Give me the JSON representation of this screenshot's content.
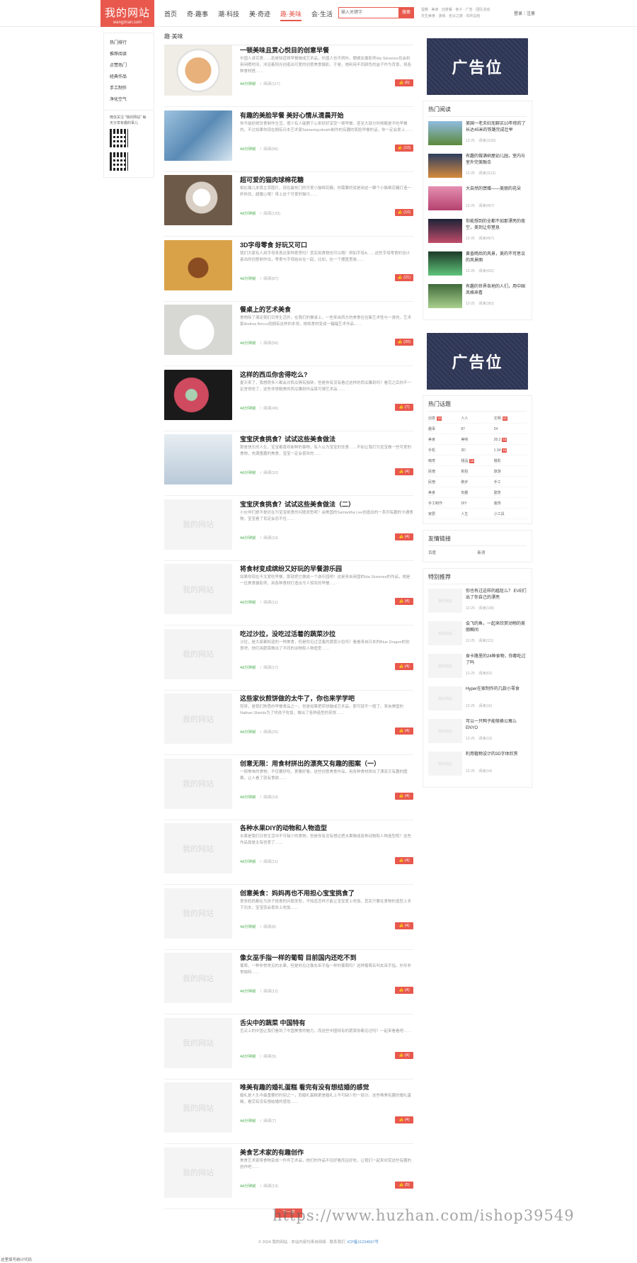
{
  "header": {
    "logo_title": "我的网站",
    "logo_sub": "wangzhan.com",
    "nav": [
      "首页",
      "奇·趣事",
      "潮·科技",
      "美·奇迹",
      "趣·美味",
      "会·生活"
    ],
    "search_placeholder": "输入关键字",
    "search_btn": "搜索",
    "hotwords_1": "蛋糕 · 美食 · 创意餐 · 亲子 · 广告 · 团队活动",
    "hotwords_2": "天生美食 · 游戏 · 舌尖之旅 · 年终总结",
    "login": "登录｜注册"
  },
  "left": {
    "menu": [
      "热门排行",
      "推荐阅读",
      "点赞热门",
      "经典作品",
      "手工制作",
      "净化空气"
    ],
    "qr_text": "微信关注 \"我的网站\" 每天分享有趣的事儿"
  },
  "main": {
    "crumb": "趣·美味",
    "items": [
      {
        "title": "一顿美味且赏心悦目的创意早餐",
        "desc": "中国人讲究食……若是知道将早餐做成艺术品，外国人也不例外。挪威女摄影师Ida Skivenes也会利用闲暇时间，沐浴着阳光创造出可爱的创意美食摄影，于是，她利用不同颜色的盒子作为背景，将各种食材搭……",
        "author": "4d分钟前",
        "reads": "阅读(117)",
        "likes": "(6)"
      },
      {
        "title": "有趣的美脸早餐 美好心情从清晨开始",
        "desc": "你不能拒绝饮食制作生活，很少有人能静下心来好好享受一顿早餐，甚至大部分时候都是不吃早餐的。不过如果你现在拥有日本艺术家Samantayokoshi制作的有趣的笑脸早餐的话，你一定会爱上……",
        "author": "4d分钟前",
        "reads": "阅读(96)",
        "likes": "(10)"
      },
      {
        "title": "超可爱的猫肉球棉花糖",
        "desc": "相比猫儿本尊主宰图片，现在最热门的可爱小猫棉花糖，你需要的就是用这一颗个小猫棉花糖打造一杯热饮，超暖心哦！带上这个可爱的猫爪……",
        "author": "4d分钟前",
        "reads": "阅读(133)",
        "likes": "(10)"
      },
      {
        "title": "3D字母零食 好玩又可口",
        "desc": "我们大家有人用字母来表达某种意思吗？其实用食物也可以哦！例如字母A……这些字母零食的设计者出的创意制作出，零食与字母结合在一起，比如，在一个摆盘里装……",
        "author": "4d分钟前",
        "reads": "阅读(87)",
        "likes": "(21)"
      },
      {
        "title": "餐桌上的艺术美食",
        "desc": "食物除了满足我们日常生活外，在我们的餐桌上，一些来自西方的美食往往集艺术性与一身的，艺术家Andrea Bricco就拥有这样的本领，她将食材变成一幅幅艺术作品……",
        "author": "4d分钟前",
        "reads": "阅读(58)",
        "likes": "(20)"
      },
      {
        "title": "这样的西瓜你舍得吃么?",
        "desc": "夏天来了，我想很多人都会对西瓜情有独钟，但是你有没有看过这样的西瓜雕刻吗？看完之后你不一定舍得吃了，这些非常精美的西瓜雕刻作品真可谓艺术品……",
        "author": "4d分钟前",
        "reads": "阅读(40)",
        "likes": "(7)"
      },
      {
        "title": "宝宝厌食挑食？试试这些美食做法",
        "desc": "那是快乐的人生，宝宝都喜欢新鲜的事物，有人认为宝宝的饮食……不如让我们为宝宝做一些可爱的食物，充满童趣的美食，宝宝一定会喜欢的……",
        "author": "4d分钟前",
        "reads": "阅读(10)",
        "likes": "(4)"
      },
      {
        "title": "宝宝厌食挑食？试试这些美食做法（二）",
        "desc": "小伙伴们是不是还在为宝宝挑食的问题发愁呢？由美国的Samantha Lee创造出的一系列有趣的卡通食物，宝宝看了肯定会忍不住……",
        "author": "4d分钟前",
        "reads": "阅读(10)",
        "likes": "(4)"
      },
      {
        "title": "将食材变成缤纷又好玩的早餐游乐园",
        "desc": "如果你现在不太爱吃早餐，那就把它做成一个游乐园吧！这是来自英国的Ida Skivenes的作品，她是一位美食摄影师，用各种食材打造出令人惊叹的早餐……",
        "author": "4d分钟前",
        "reads": "阅读(11)",
        "likes": "(4)"
      },
      {
        "title": "吃过沙拉，没吃过活着的蔬菜沙拉",
        "desc": "沙拉，是大家都知道的一种美食，但是你见过活着的蔬菜沙拉吗？看看来自日本的Blue Dragon的创意吧，他们用蔬菜做出了不同的动物和人物造型……",
        "author": "4d分钟前",
        "reads": "阅读(17)",
        "likes": "(4)"
      },
      {
        "title": "这些家伙煎饼做的太牛了，你也来学学吧",
        "desc": "煎饼，是我们熟悉的早餐食品之一。但是如果把煎饼做成艺术品，那可就不一般了。来自美国的Nathan Shields为了哄孩子吃饭，做出了各种造型的煎饼……",
        "author": "4d分钟前",
        "reads": "阅读(20)",
        "likes": "(4)"
      },
      {
        "title": "创意无限：用食材拼出的漂亮又有趣的图案（一）",
        "desc": "一顿美味的食物，不仅要好吃，更要好看。这些创意美食作品，用各种食材拼出了漂亮又有趣的图案，让人看了就有食欲……",
        "author": "4d分钟前",
        "reads": "阅读(10)",
        "likes": "(4)"
      },
      {
        "title": "各种水果DIY的动物和人物造型",
        "desc": "水果是我们日常生活中不可缺少的食物，但是你有没有想过把水果做成各种动物和人物造型呢？这些作品真是太有创意了……",
        "author": "4d分钟前",
        "reads": "阅读(11)",
        "likes": "(4)"
      },
      {
        "title": "创意美食：妈妈再也不用担心宝宝挑食了",
        "desc": "很多妈妈都在为孩子挑食的问题发愁，不知道怎样才能让宝宝爱上吃饭。其实只要在食物的造型上多下功夫，宝宝就会喜欢上吃饭……",
        "author": "4d分钟前",
        "reads": "阅读(8)",
        "likes": "(4)"
      },
      {
        "title": "像女巫手指一样的葡萄 目前国内还吃不到",
        "desc": "葡萄，一种非常常见的水果，但是你见过像女巫手指一样的葡萄吗？这种葡萄名叫女巫手指，外形非常独特……",
        "author": "4d分钟前",
        "reads": "阅读(12)",
        "likes": "(4)"
      },
      {
        "title": "舌尖中的蔬菜 中国特有",
        "desc": "舌尖上的中国让我们看到了中国美食的魅力，而这些中国特有的蔬菜你都见过吗？一起来看看吧……",
        "author": "4d分钟前",
        "reads": "阅读(9)",
        "likes": "(4)"
      },
      {
        "title": "唯美有趣的婚礼蛋糕 看完有没有想结婚的感觉",
        "desc": "婚礼是人生中最重要的时刻之一，而婚礼蛋糕更是婚礼上不可缺少的一部分。这些唯美有趣的婚礼蛋糕，看完有没有想结婚的感觉……",
        "author": "4d分钟前",
        "reads": "阅读(7)",
        "likes": "(4)"
      },
      {
        "title": "美食艺术家的有趣创作",
        "desc": "美食艺术家将食物变成一件件艺术品，他们的作品不仅好看而且好吃，让我们一起来欣赏这些有趣的创作吧……",
        "author": "4d分钟前",
        "reads": "阅读(13)",
        "likes": "(5)"
      }
    ],
    "placeholder_text": "我的网站",
    "next_page": "下一页"
  },
  "right": {
    "ad_text": "广告位",
    "hot_title": "热门阅读",
    "hot": [
      {
        "title": "美国一老夫妇无聊买10年修的了长达45米的铁路完成壮举",
        "date": "12-25",
        "reads": "阅读(1192)"
      },
      {
        "title": "有趣的做满树屋幼儿园，室内与室外完美融合",
        "date": "12-25",
        "reads": "阅读(1113)"
      },
      {
        "title": "大自然的馈赠——美丽的花朵",
        "date": "12-25",
        "reads": "阅读(457)"
      },
      {
        "title": "你能想到的全都不如那漂亮的夜空，美到让你窒息",
        "date": "12-25",
        "reads": "阅读(457)"
      },
      {
        "title": "黄昏雨后的风景，美的不可思议的风景图",
        "date": "12-25",
        "reads": "阅读(432)"
      },
      {
        "title": "有趣的世界各地的人们，用中国风格来看",
        "date": "12-25",
        "reads": "阅读(382)"
      }
    ],
    "tags_title": "热门话题",
    "tags": [
      [
        "创意",
        "15"
      ],
      [
        "人人",
        "0"
      ],
      [
        "文明",
        "15"
      ],
      [
        "趣事",
        "0"
      ],
      [
        "87",
        "0"
      ],
      [
        "24",
        "0"
      ],
      [
        "美食",
        "0"
      ],
      [
        "美味",
        "0"
      ],
      [
        "28.2",
        "15"
      ],
      [
        "手机",
        "0"
      ],
      [
        "3D",
        "0"
      ],
      [
        "1.34",
        "15"
      ],
      [
        "萌宠",
        "0"
      ],
      [
        "甜品",
        "15"
      ],
      [
        "摄影",
        "0"
      ],
      [
        "民宿",
        "0"
      ],
      [
        "街拍",
        "0"
      ],
      [
        "旅游",
        "0"
      ],
      [
        "民宿",
        "0"
      ],
      [
        "跑步",
        "0"
      ],
      [
        "手工",
        "0"
      ],
      [
        "美食",
        "0"
      ],
      [
        "有趣",
        "0"
      ],
      [
        "建筑",
        "0"
      ],
      [
        "手工制作",
        "0"
      ],
      [
        "DIY",
        "0"
      ],
      [
        "装饰",
        "0"
      ],
      [
        "家居",
        "0"
      ],
      [
        "人生",
        "0"
      ],
      [
        "小工具",
        "0"
      ]
    ],
    "links_title": "友情链接",
    "links": [
      "百度",
      "新浪"
    ],
    "rec_title": "特别推荐",
    "rec": [
      {
        "title": "你也有过这样的尴尬么？ EVE们出了你自己的漂亮",
        "date": "12-25",
        "reads": "阅读(108)"
      },
      {
        "title": "会飞的鱼，一起来欣赏动物的美丽瞬间",
        "date": "12-25",
        "reads": "阅读(111)"
      },
      {
        "title": "食卡路里的24种食物，你都吃过了吗",
        "date": "12-25",
        "reads": "阅读(63)"
      },
      {
        "title": "Hyper在家制作的几款小零食",
        "date": "12-25",
        "reads": "阅读(16)"
      },
      {
        "title": "可以一只鸭子能够换公寓么ENYO",
        "date": "12-25",
        "reads": "阅读(13)"
      },
      {
        "title": "利用植物设计的3D字体欣赏",
        "date": "12-25",
        "reads": "阅读(14)"
      }
    ]
  },
  "footer": {
    "copy": "© 2024 我的网站 · 本站内容均来自网络 · 联系我们",
    "icp": "ICP备11234567号",
    "stat": "这里填写统计代码",
    "watermark": "https://www.huzhan.com/ishop39549"
  }
}
